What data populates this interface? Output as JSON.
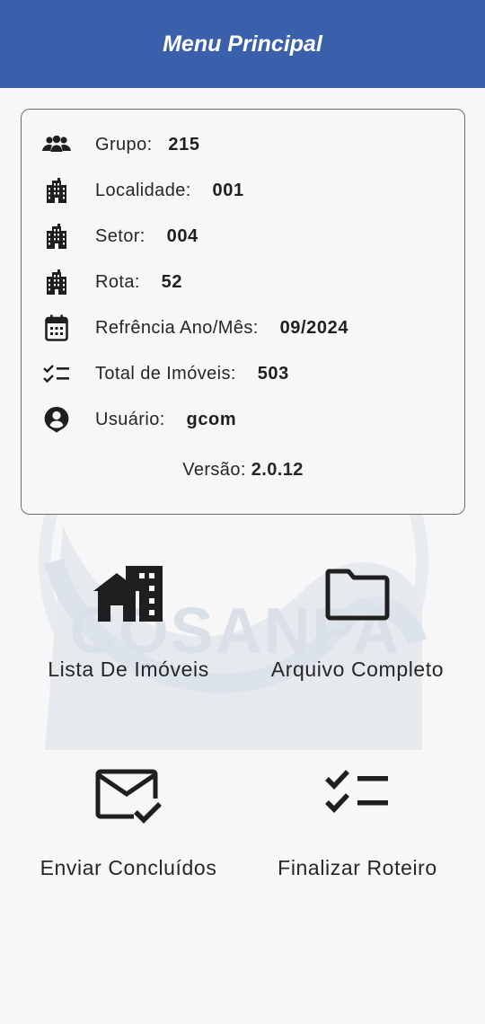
{
  "appbar": {
    "title": "Menu Principal"
  },
  "watermark": {
    "text": "COSANPA"
  },
  "info": {
    "rows": [
      {
        "icon": "group-icon",
        "label": "Grupo:",
        "value": "215"
      },
      {
        "icon": "building-icon",
        "label": "Localidade:",
        "value": "001"
      },
      {
        "icon": "building-icon",
        "label": "Setor:",
        "value": "004"
      },
      {
        "icon": "building-icon",
        "label": "Rota:",
        "value": "52"
      },
      {
        "icon": "calendar-icon",
        "label": "Refrência Ano/Mês:",
        "value": "09/2024"
      },
      {
        "icon": "checklist-icon",
        "label": "Total de Imóveis:",
        "value": "503"
      },
      {
        "icon": "account-circle-icon",
        "label": "Usuário:",
        "value": "gcom"
      }
    ],
    "version_label": "Versão:",
    "version_value": "2.0.12"
  },
  "menu": {
    "items": [
      {
        "icon": "houses-icon",
        "label": "Lista De Imóveis"
      },
      {
        "icon": "folder-icon",
        "label": "Arquivo Completo"
      },
      {
        "icon": "mail-check-icon",
        "label": "Enviar Concluídos"
      },
      {
        "icon": "checklist-icon",
        "label": "Finalizar Roteiro"
      }
    ]
  },
  "colors": {
    "appbar": "#3a60ac",
    "background": "#f7f7f7",
    "text": "#1f1f1f",
    "watermark": "#d7dfe9"
  }
}
